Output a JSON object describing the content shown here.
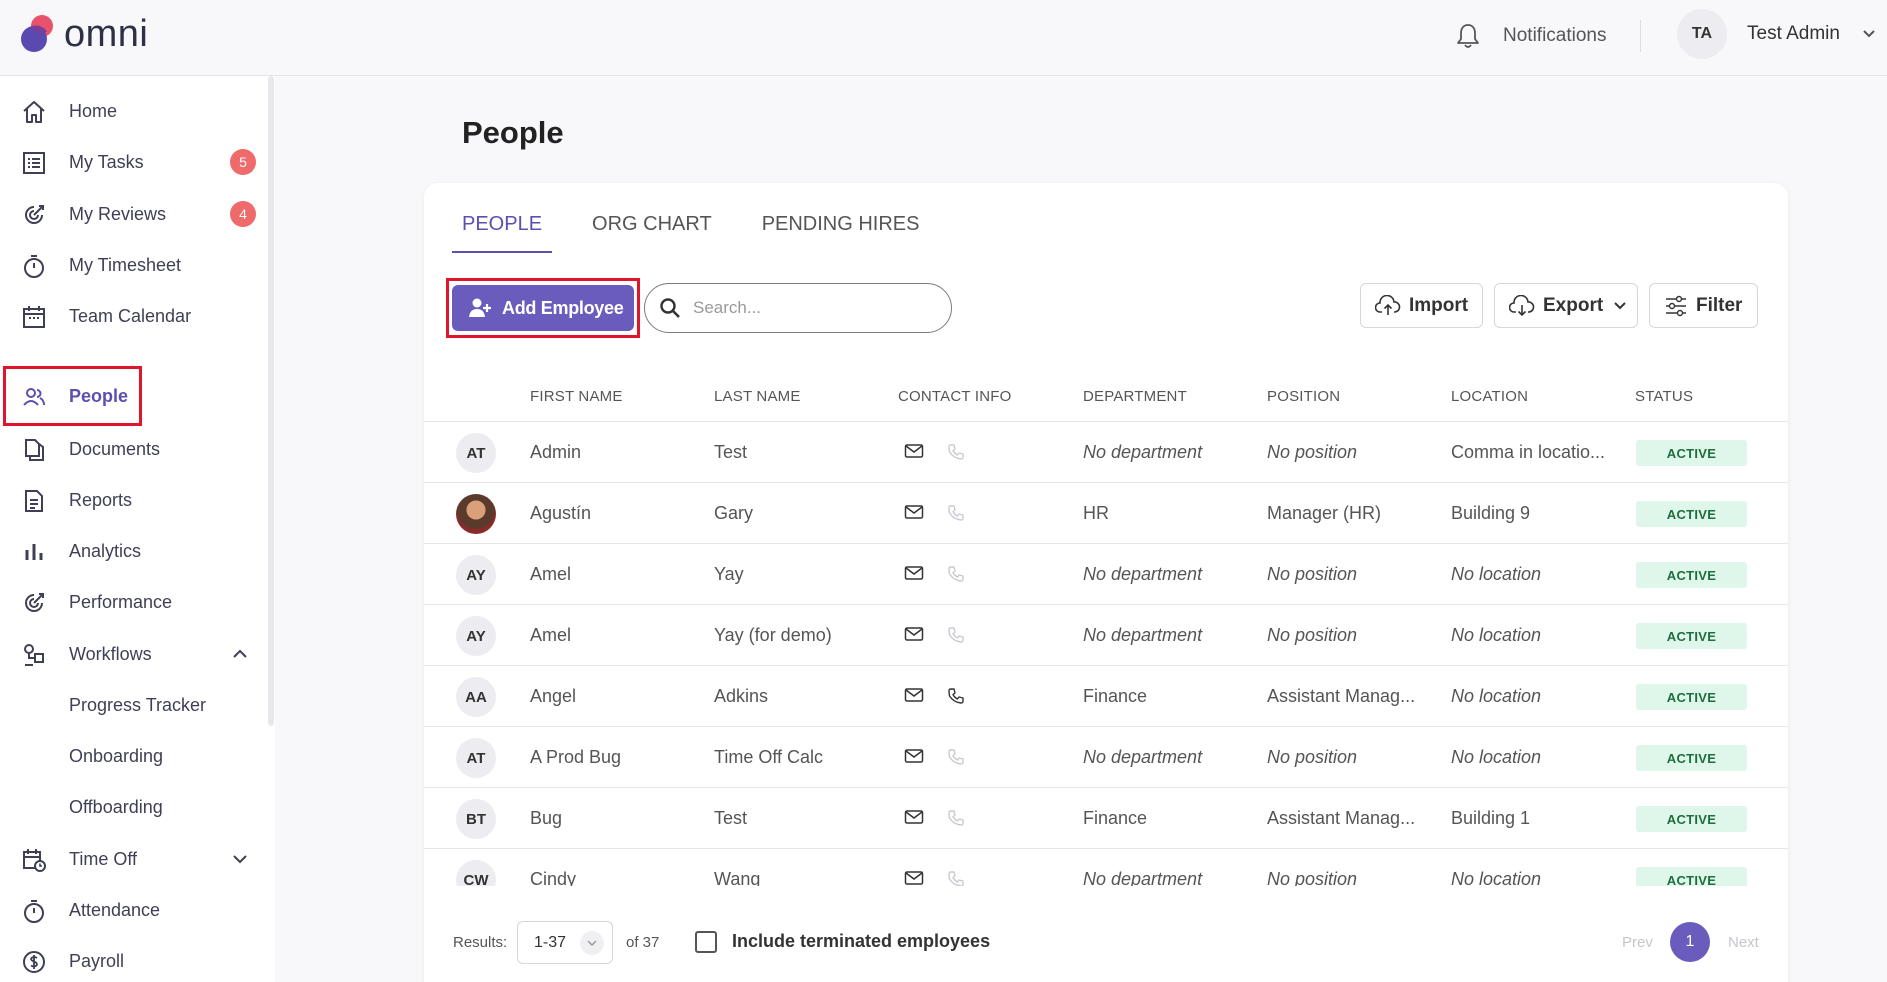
{
  "header": {
    "logo_text": "omni",
    "notifications_label": "Notifications",
    "user_initials": "TA",
    "user_name": "Test Admin"
  },
  "sidebar": {
    "items": [
      {
        "label": "Home"
      },
      {
        "label": "My Tasks",
        "badge": "5"
      },
      {
        "label": "My Reviews",
        "badge": "4"
      },
      {
        "label": "My Timesheet"
      },
      {
        "label": "Team Calendar"
      },
      {
        "label": "People"
      },
      {
        "label": "Documents"
      },
      {
        "label": "Reports"
      },
      {
        "label": "Analytics"
      },
      {
        "label": "Performance"
      },
      {
        "label": "Workflows"
      },
      {
        "label": "Progress Tracker"
      },
      {
        "label": "Onboarding"
      },
      {
        "label": "Offboarding"
      },
      {
        "label": "Time Off"
      },
      {
        "label": "Attendance"
      },
      {
        "label": "Payroll"
      }
    ]
  },
  "page": {
    "title": "People",
    "tabs": [
      {
        "label": "PEOPLE"
      },
      {
        "label": "ORG CHART"
      },
      {
        "label": "PENDING HIRES"
      }
    ]
  },
  "toolbar": {
    "add_label": "Add Employee",
    "search_placeholder": "Search...",
    "import_label": "Import",
    "export_label": "Export",
    "filter_label": "Filter"
  },
  "table": {
    "columns": [
      "FIRST NAME",
      "LAST NAME",
      "CONTACT INFO",
      "DEPARTMENT",
      "POSITION",
      "LOCATION",
      "STATUS"
    ],
    "rows": [
      {
        "initials": "AT",
        "first": "Admin",
        "last": "Test",
        "department": "No department",
        "position": "No position",
        "location": "Comma in locatio...",
        "status": "ACTIVE"
      },
      {
        "initials": "",
        "first": "Agustín",
        "last": "Gary",
        "department": "HR",
        "position": "Manager (HR)",
        "location": "Building 9",
        "status": "ACTIVE"
      },
      {
        "initials": "AY",
        "first": "Amel",
        "last": "Yay",
        "department": "No department",
        "position": "No position",
        "location": "No location",
        "status": "ACTIVE"
      },
      {
        "initials": "AY",
        "first": "Amel",
        "last": "Yay (for demo)",
        "department": "No department",
        "position": "No position",
        "location": "No location",
        "status": "ACTIVE"
      },
      {
        "initials": "AA",
        "first": "Angel",
        "last": "Adkins",
        "department": "Finance",
        "position": "Assistant Manag...",
        "location": "No location",
        "status": "ACTIVE"
      },
      {
        "initials": "AT",
        "first": "A Prod Bug",
        "last": "Time Off Calc",
        "department": "No department",
        "position": "No position",
        "location": "No location",
        "status": "ACTIVE"
      },
      {
        "initials": "BT",
        "first": "Bug",
        "last": "Test",
        "department": "Finance",
        "position": "Assistant Manag...",
        "location": "Building 1",
        "status": "ACTIVE"
      },
      {
        "initials": "CW",
        "first": "Cindy",
        "last": "Wang",
        "department": "No department",
        "position": "No position",
        "location": "No location",
        "status": "ACTIVE"
      }
    ]
  },
  "footer": {
    "results_label": "Results:",
    "range": "1-37",
    "of_total": "of 37",
    "include_terminated_label": "Include terminated employees",
    "prev_label": "Prev",
    "page": "1",
    "next_label": "Next"
  },
  "colors": {
    "accent": "#6a5cbd",
    "badge": "#ef6a6a",
    "status_bg": "#dff7ea",
    "highlight": "#e0142a"
  }
}
